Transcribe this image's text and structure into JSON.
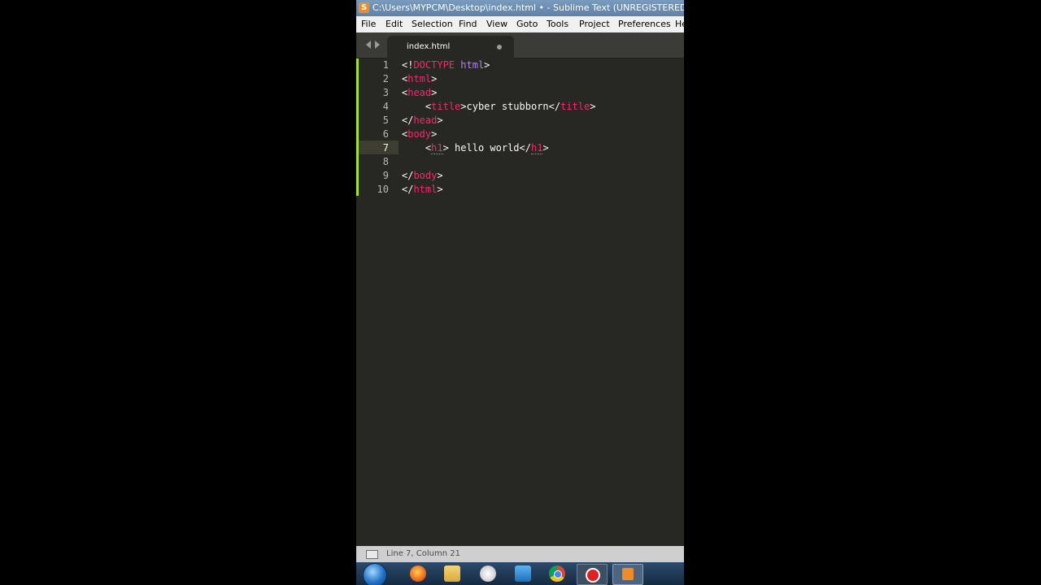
{
  "window": {
    "title": "C:\\Users\\MYPCM\\Desktop\\index.html • - Sublime Text (UNREGISTERED)"
  },
  "menu": [
    "File",
    "Edit",
    "Selection",
    "Find",
    "View",
    "Goto",
    "Tools",
    "Project",
    "Preferences",
    "He"
  ],
  "tab": {
    "label": "index.html",
    "dirty": true
  },
  "editor": {
    "line_numbers": [
      "1",
      "2",
      "3",
      "4",
      "5",
      "6",
      "7",
      "8",
      "9",
      "10"
    ],
    "current_line": 7
  },
  "status": {
    "text": "Line 7, Column 21"
  },
  "colors": {
    "background": "#272822",
    "tag": "#f92672",
    "keyword": "#ae81ff",
    "text": "#f8f8f2",
    "gutter_accent": "#a6e22e"
  },
  "taskbar": {
    "items": [
      "windows-start-icon",
      "firefox-icon",
      "folder-icon",
      "paint-icon",
      "blue-app-icon",
      "chrome-icon",
      "recorder-icon",
      "sublime-icon"
    ]
  }
}
